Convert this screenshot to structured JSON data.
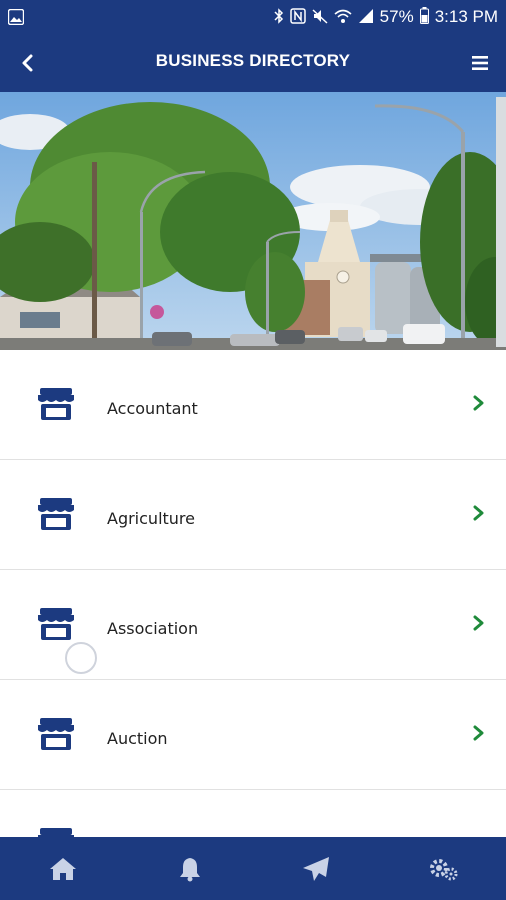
{
  "status_bar": {
    "battery": "57%",
    "time": "3:13 PM"
  },
  "header": {
    "title": "BUSINESS DIRECTORY",
    "back_icon": "chevron-left-icon",
    "menu_icon": "hamburger-menu-icon"
  },
  "hero": {
    "image": "town-street-with-grain-elevators-photo"
  },
  "directory": {
    "items": [
      {
        "label": "Accountant"
      },
      {
        "label": "Agriculture"
      },
      {
        "label": "Association"
      },
      {
        "label": "Auction"
      },
      {
        "label": ""
      }
    ]
  },
  "bottom_nav": {
    "icons": [
      "home-icon",
      "bell-icon",
      "send-icon",
      "settings-icon"
    ]
  },
  "colors": {
    "brand": "#1c3a80",
    "chevron": "#1f8a3a",
    "divider": "#e1e1e1"
  }
}
